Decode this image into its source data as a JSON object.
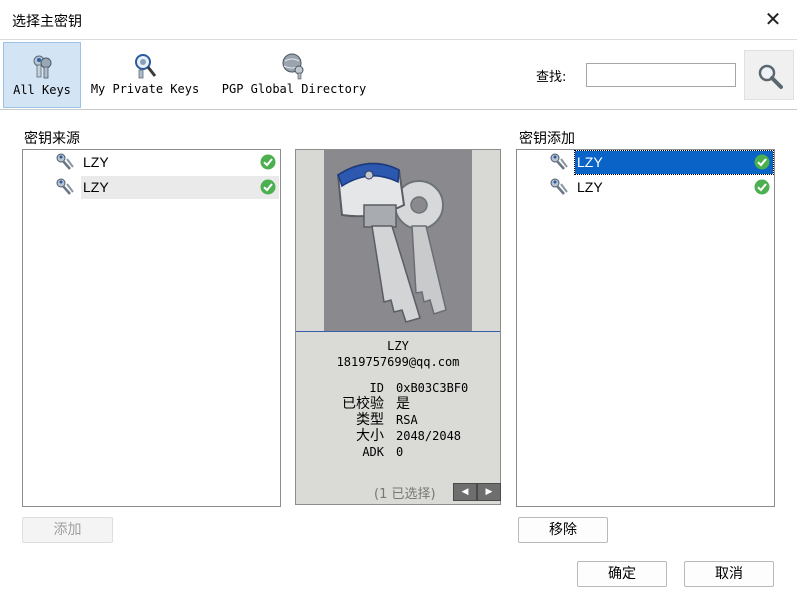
{
  "window": {
    "title": "选择主密钥",
    "close_glyph": "✕"
  },
  "toolbar": {
    "tabs": [
      {
        "label": "All Keys",
        "icon": "keys-icon",
        "selected": true
      },
      {
        "label": "My Private Keys",
        "icon": "key-search-icon",
        "selected": false
      },
      {
        "label": "PGP Global Directory",
        "icon": "globe-key-icon",
        "selected": false
      }
    ],
    "find_label": "查找:",
    "find_value": "",
    "find_button_icon": "magnifier-icon"
  },
  "source": {
    "label": "密钥来源",
    "rows": [
      {
        "name": "LZY",
        "status": "valid",
        "hover": false
      },
      {
        "name": "LZY",
        "status": "valid",
        "hover": true
      }
    ],
    "add_button": "添加"
  },
  "added": {
    "label": "密钥添加",
    "rows": [
      {
        "name": "LZY",
        "status": "valid",
        "selected": true
      },
      {
        "name": "LZY",
        "status": "valid",
        "selected": false
      }
    ],
    "remove_button": "移除"
  },
  "detail": {
    "image": "keys-illustration",
    "name": "LZY",
    "email": "1819757699@qq.com",
    "props": {
      "id_label": "ID",
      "id_value": "0xB03C3BF0",
      "verified_label": "已校验",
      "verified_value": "是",
      "type_label": "类型",
      "type_value": "RSA",
      "size_label": "大小",
      "size_value": "2048/2048",
      "adk_label": "ADK",
      "adk_value": "0"
    },
    "selection": "(1 已选择)",
    "prev_glyph": "◀",
    "next_glyph": "▶"
  },
  "footer": {
    "ok": "确定",
    "cancel": "取消"
  },
  "colors": {
    "selection": "#0a64c8",
    "valid": "#4caf50",
    "tab_selected": "#d3e4f4"
  }
}
